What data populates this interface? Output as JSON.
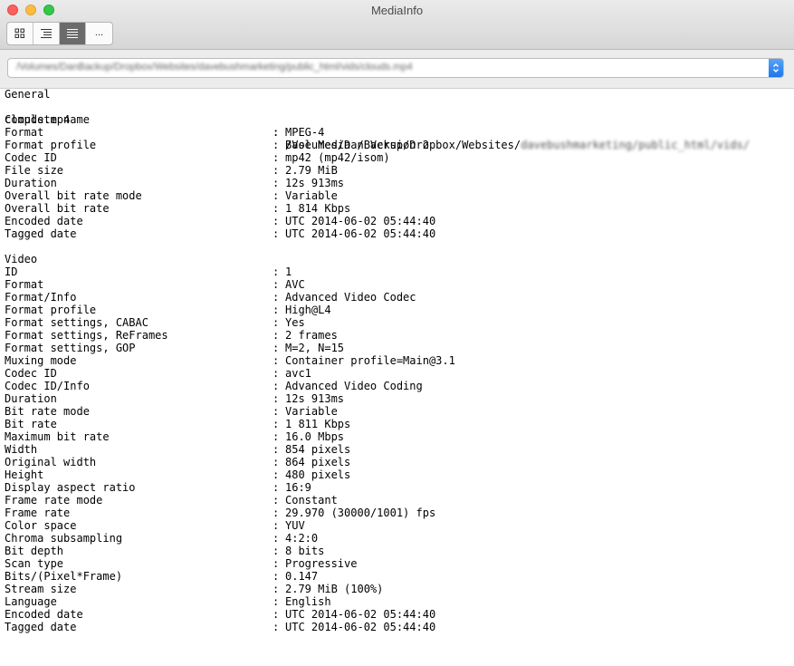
{
  "window": {
    "title": "MediaInfo"
  },
  "toolbar": {
    "buttons": [
      {
        "name": "basic-view-button",
        "icon": "grid-icon",
        "active": false
      },
      {
        "name": "sheet-view-button",
        "icon": "outline-list-icon",
        "active": false
      },
      {
        "name": "text-view-button",
        "icon": "text-lines-icon",
        "active": true
      },
      {
        "name": "more-views-button",
        "icon": "ellipsis-icon",
        "label": "...",
        "active": false
      }
    ]
  },
  "path_selector": {
    "value": "/Volumes/DanBackup/Dropbox/Websites/davebushmarketing/public_html/vids/clouds.mp4",
    "icon": "up-down-chevron-icon"
  },
  "general": {
    "header": "General",
    "complete_name": {
      "label": "Complete name",
      "value_visible": "/Volumes/DanBackup/Dropbox/Websites/",
      "value_blurred": "davebushmarketing/public_html/vids/",
      "continuation": "clouds.mp4"
    },
    "fields": [
      {
        "label": "Format",
        "value": "MPEG-4"
      },
      {
        "label": "Format profile",
        "value": "Base Media / Version 2"
      },
      {
        "label": "Codec ID",
        "value": "mp42 (mp42/isom)"
      },
      {
        "label": "File size",
        "value": "2.79 MiB"
      },
      {
        "label": "Duration",
        "value": "12s 913ms"
      },
      {
        "label": "Overall bit rate mode",
        "value": "Variable"
      },
      {
        "label": "Overall bit rate",
        "value": "1 814 Kbps"
      },
      {
        "label": "Encoded date",
        "value": "UTC 2014-06-02 05:44:40"
      },
      {
        "label": "Tagged date",
        "value": "UTC 2014-06-02 05:44:40"
      }
    ]
  },
  "video": {
    "header": "Video",
    "fields": [
      {
        "label": "ID",
        "value": "1"
      },
      {
        "label": "Format",
        "value": "AVC"
      },
      {
        "label": "Format/Info",
        "value": "Advanced Video Codec"
      },
      {
        "label": "Format profile",
        "value": "High@L4"
      },
      {
        "label": "Format settings, CABAC",
        "value": "Yes"
      },
      {
        "label": "Format settings, ReFrames",
        "value": "2 frames"
      },
      {
        "label": "Format settings, GOP",
        "value": "M=2, N=15"
      },
      {
        "label": "Muxing mode",
        "value": "Container profile=Main@3.1"
      },
      {
        "label": "Codec ID",
        "value": "avc1"
      },
      {
        "label": "Codec ID/Info",
        "value": "Advanced Video Coding"
      },
      {
        "label": "Duration",
        "value": "12s 913ms"
      },
      {
        "label": "Bit rate mode",
        "value": "Variable"
      },
      {
        "label": "Bit rate",
        "value": "1 811 Kbps"
      },
      {
        "label": "Maximum bit rate",
        "value": "16.0 Mbps"
      },
      {
        "label": "Width",
        "value": "854 pixels"
      },
      {
        "label": "Original width",
        "value": "864 pixels"
      },
      {
        "label": "Height",
        "value": "480 pixels"
      },
      {
        "label": "Display aspect ratio",
        "value": "16:9"
      },
      {
        "label": "Frame rate mode",
        "value": "Constant"
      },
      {
        "label": "Frame rate",
        "value": "29.970 (30000/1001) fps"
      },
      {
        "label": "Color space",
        "value": "YUV"
      },
      {
        "label": "Chroma subsampling",
        "value": "4:2:0"
      },
      {
        "label": "Bit depth",
        "value": "8 bits"
      },
      {
        "label": "Scan type",
        "value": "Progressive"
      },
      {
        "label": "Bits/(Pixel*Frame)",
        "value": "0.147"
      },
      {
        "label": "Stream size",
        "value": "2.79 MiB (100%)"
      },
      {
        "label": "Language",
        "value": "English"
      },
      {
        "label": "Encoded date",
        "value": "UTC 2014-06-02 05:44:40"
      },
      {
        "label": "Tagged date",
        "value": "UTC 2014-06-02 05:44:40"
      }
    ]
  },
  "colors": {
    "close": "#fc605c",
    "minimize": "#fdbc40",
    "zoom": "#34c84a",
    "accent": "#1c76ee",
    "active_segment": "#6b6b6b"
  }
}
